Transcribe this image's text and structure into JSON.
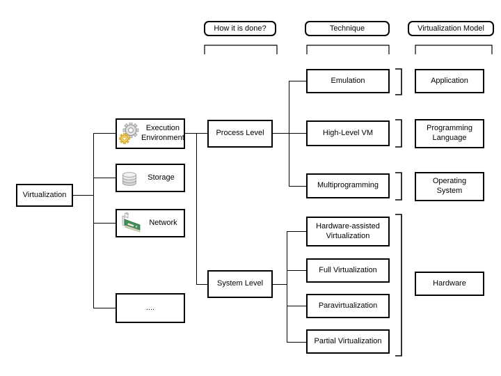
{
  "diagram": {
    "title_headers": [
      {
        "id": "how-it-is-done",
        "label": "How it is done?"
      },
      {
        "id": "technique",
        "label": "Technique"
      },
      {
        "id": "virtualization-model",
        "label": "Virtualization Model"
      }
    ],
    "root": {
      "label": "Virtualization"
    },
    "areas": [
      {
        "id": "execution-environment",
        "label": "Execution\nEnvironment",
        "icon": "gears-icon"
      },
      {
        "id": "storage",
        "label": "Storage",
        "icon": "database-icon"
      },
      {
        "id": "network",
        "label": "Network",
        "icon": "network-card-icon"
      },
      {
        "id": "more",
        "label": "....",
        "icon": "none"
      }
    ],
    "levels": [
      {
        "id": "process-level",
        "label": "Process Level"
      },
      {
        "id": "system-level",
        "label": "System Level"
      }
    ],
    "techniques_process": [
      {
        "id": "emulation",
        "label": "Emulation"
      },
      {
        "id": "high-level-vm",
        "label": "High-Level VM"
      },
      {
        "id": "multiprogramming",
        "label": "Multiprogramming"
      }
    ],
    "techniques_system": [
      {
        "id": "hardware-assisted-virtualization",
        "label": "Hardware-assisted\nVirtualization"
      },
      {
        "id": "full-virtualization",
        "label": "Full Virtualization"
      },
      {
        "id": "paravirtualization",
        "label": "Paravirtualization"
      },
      {
        "id": "partial-virtualization",
        "label": "Partial Virtualization"
      }
    ],
    "models": [
      {
        "id": "application",
        "label": "Application"
      },
      {
        "id": "programming-language",
        "label": "Programming\nLanguage"
      },
      {
        "id": "operating-system",
        "label": "Operating\nSystem"
      },
      {
        "id": "hardware",
        "label": "Hardware"
      }
    ],
    "colors": {
      "stroke": "#000000",
      "background": "#ffffff",
      "gear_gray": "#d8d8d8",
      "gear_gold": "#f2c94c",
      "disk_gray": "#dcdcdc",
      "nic_green": "#3f8f56"
    }
  }
}
